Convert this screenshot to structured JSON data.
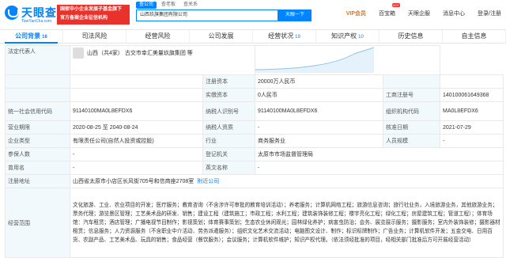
{
  "header": {
    "logo_text": "天眼查",
    "logo_sub": "TianYanCha.com",
    "promo_lines": [
      "国家中小企业发展子基金旗下",
      "官方备案企业征信机构"
    ],
    "query_tabs": [
      "查公司",
      "查老板",
      "查关系"
    ],
    "search_value": "山西玖旗集团有限公司",
    "search_button": "天眼一下",
    "nav": [
      "VIP会员",
      "百宝箱",
      "天眼企服",
      "消息中心",
      "登录/注册"
    ],
    "hot_badge": "HOT"
  },
  "tabs": [
    {
      "label": "公司背景",
      "count": "16",
      "active": true
    },
    {
      "label": "司法风险",
      "count": "",
      "active": false
    },
    {
      "label": "经营风险",
      "count": "",
      "active": false
    },
    {
      "label": "公司发展",
      "count": "",
      "active": false
    },
    {
      "label": "经营状况",
      "count": "19",
      "active": false
    },
    {
      "label": "知识产权",
      "count": "10",
      "active": false
    },
    {
      "label": "历史信息",
      "count": "",
      "active": false
    },
    {
      "label": "自主信息",
      "count": "",
      "active": false
    }
  ],
  "info": {
    "legal_rep_label": "法定代表人",
    "legal_rep_value": "山西（共4家）      古交市幸汇美量玖旗集团    等",
    "reg_capital_label": "注册资本",
    "reg_capital_value": "20000万人民币",
    "paid_capital_label": "实缴资本",
    "paid_capital_value": "0人民币",
    "biz_reg_no_label": "工商注册号",
    "biz_reg_no_value": "140100061649368",
    "credit_code_label": "统一社会信用代码",
    "credit_code_value": "91140100MA0L8EFDX6",
    "taxpayer_id_label": "纳税人识别号",
    "taxpayer_id_value": "91140100MA0L8EFDX6",
    "org_code_label": "组织机构代码",
    "org_code_value": "MA0L8EFDX6",
    "term_label": "营业期限",
    "term_value": "2020-08-25 至 2040-08-24",
    "taxpayer_qual_label": "纳税人资质",
    "taxpayer_qual_value": "-",
    "approve_date_label": "核准日期",
    "approve_date_value": "2021-07-29",
    "type_label": "企业类型",
    "type_value": "有限责任公司(自然人投资或控股)",
    "industry_label": "行业",
    "industry_value": "商务服务业",
    "staff_label": "人员规模",
    "staff_value": "-",
    "insured_label": "参保人数",
    "insured_value": "-",
    "authority_label": "登记机关",
    "authority_value": "太原市市场监督管理局",
    "former_name_label": "曾用名",
    "former_name_value": "-",
    "english_name_label": "英文名称",
    "english_name_value": "-",
    "address_label": "注册地址",
    "address_value": "山西省太原市小店区长风街705号和信商座2708室",
    "address_link": "附近公司",
    "scope_label": "经营范围",
    "scope_value": "文化旅游、工业、农业项目的开发；医疗服务；教育咨询（不含涉许可审批的教育培训活动）；养老服务；计算机网络工程；旅游信息咨询；旅行社业务，入境旅游业务，其他旅游业务；票务代理；游览景区管理；工艺美术品的研发、销售；建设工程（建筑施工；市政工程；水利工程；建筑装饰装修工程；楼宇亮化工程；绿化工程；房屋建筑工程；管道工程）；体育场馆：汽车租赁；酒店管理；广播电视节目制作；影视策划；体育赛事策划；生态农业休闲观光；园林绿化养护；病害虫防治；会务、展览展示服务；摄影服务；室内外装饰装修；摄影器材租赁；信息服务；人力资源服务（不含职业中介活动、劳务派遣服务）；组织文化艺术交流活动；电脑图文设计、制作；标识标牌制作；广告业务；计算机软件开发；五金交电、日用百货、农副产品、工艺美术品、玩具的销售；食品经营（餐饮服务）；会议服务；计算机软件维护；知识产权代理。（依法须经批准的项目，经相关部门批准后方可开展经营活动）"
  }
}
